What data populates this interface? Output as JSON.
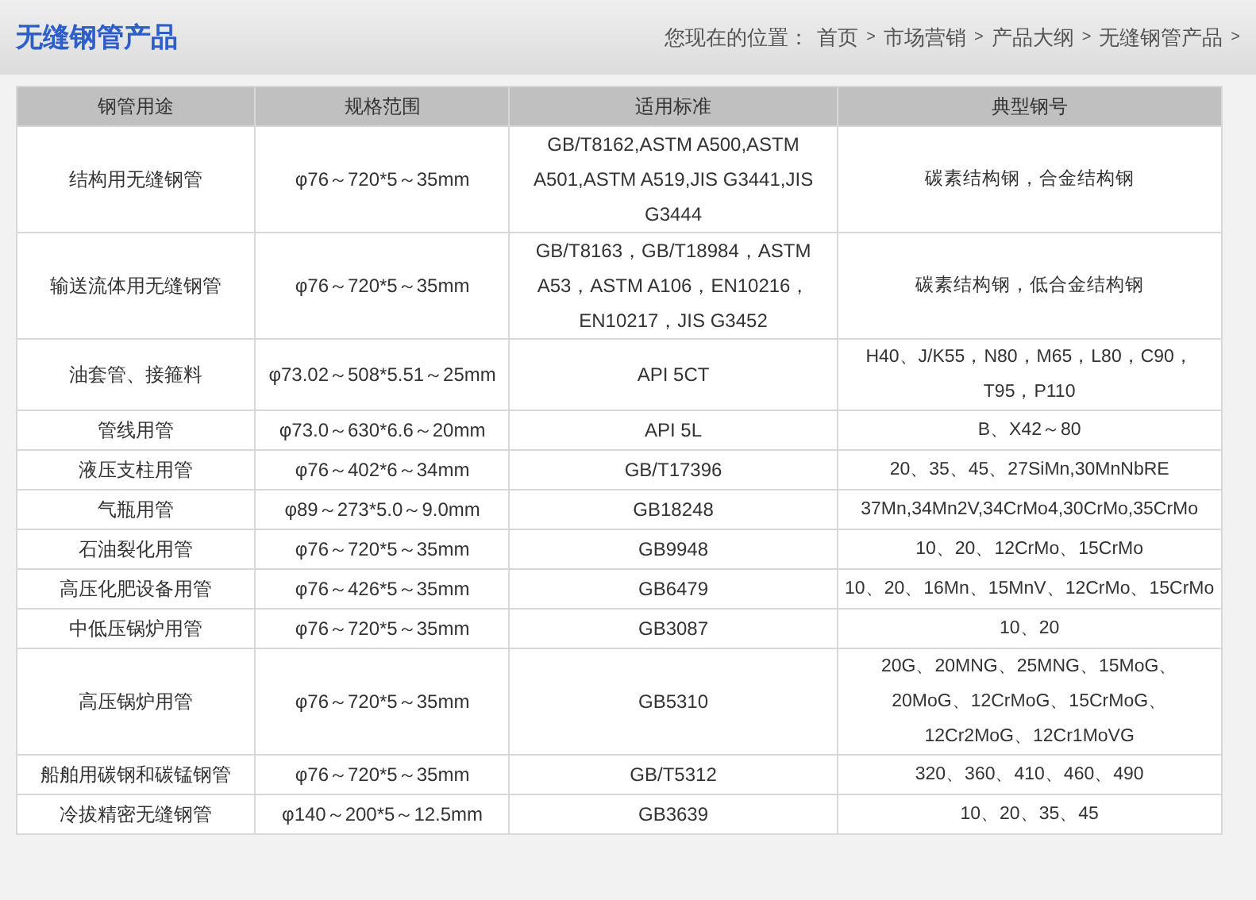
{
  "header": {
    "title": "无缝钢管产品",
    "location_label": "您现在的位置：",
    "breadcrumb": [
      {
        "label": "首页",
        "separator": ">"
      },
      {
        "label": "市场营销",
        "separator": ">"
      },
      {
        "label": "产品大纲",
        "separator": ">"
      },
      {
        "label": "无缝钢管产品",
        "separator": ">"
      }
    ]
  },
  "table": {
    "columns": [
      "钢管用途",
      "规格范围",
      "适用标准",
      "典型钢号"
    ],
    "rows": [
      [
        "结构用无缝钢管",
        "φ76～720*5～35mm",
        "GB/T8162,ASTM A500,ASTM A501,ASTM A519,JIS G3441,JIS G3444",
        "碳素结构钢，合金结构钢"
      ],
      [
        "输送流体用无缝钢管",
        "φ76～720*5～35mm",
        "GB/T8163，GB/T18984，ASTM A53，ASTM A106，EN10216，EN10217，JIS G3452",
        "碳素结构钢，低合金结构钢"
      ],
      [
        "油套管、接箍料",
        "φ73.02～508*5.51～25mm",
        "API 5CT",
        "H40、J/K55，N80，M65，L80，C90，T95，P110"
      ],
      [
        "管线用管",
        "φ73.0～630*6.6～20mm",
        "API 5L",
        "B、X42～80"
      ],
      [
        "液压支柱用管",
        "φ76～402*6～34mm",
        "GB/T17396",
        "20、35、45、27SiMn,30MnNbRE"
      ],
      [
        "气瓶用管",
        "φ89～273*5.0～9.0mm",
        "GB18248",
        "37Mn,34Mn2V,34CrMo4,30CrMo,35CrMo"
      ],
      [
        "石油裂化用管",
        "φ76～720*5～35mm",
        "GB9948",
        "10、20、12CrMo、15CrMo"
      ],
      [
        "高压化肥设备用管",
        "φ76～426*5～35mm",
        "GB6479",
        "10、20、16Mn、15MnV、12CrMo、15CrMo"
      ],
      [
        "中低压锅炉用管",
        "φ76～720*5～35mm",
        "GB3087",
        "10、20"
      ],
      [
        "高压锅炉用管",
        "φ76～720*5～35mm",
        "GB5310",
        "20G、20MNG、25MNG、15MoG、20MoG、12CrMoG、15CrMoG、12Cr2MoG、12Cr1MoVG"
      ],
      [
        "船舶用碳钢和碳锰钢管",
        "φ76～720*5～35mm",
        "GB/T5312",
        "320、360、410、460、490"
      ],
      [
        "冷拔精密无缝钢管",
        "φ140～200*5～12.5mm",
        "GB3639",
        "10、20、35、45"
      ]
    ]
  }
}
